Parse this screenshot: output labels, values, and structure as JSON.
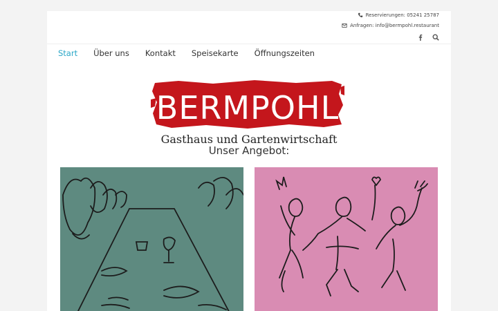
{
  "header": {
    "reservation": "Reservierungen: 05241 25787",
    "inquiries": "Anfragen: info@bermpohl.restaurant",
    "icons": [
      "phone-icon",
      "envelope-icon",
      "facebook-icon",
      "search-icon"
    ]
  },
  "nav": {
    "items": [
      {
        "label": "Start",
        "active": true
      },
      {
        "label": "Über uns"
      },
      {
        "label": "Kontakt"
      },
      {
        "label": "Speisekarte"
      },
      {
        "label": "Öffnungszeiten"
      }
    ]
  },
  "brand": {
    "logo_text": "BERMPOHL",
    "tagline": "Gasthaus und Gartenwirtschaft",
    "logo_color": "#c4161c"
  },
  "main": {
    "section_title": "Unser Angebot:",
    "cards": [
      {
        "name": "restaurant-illustration",
        "color": "#5e8a80"
      },
      {
        "name": "dancing-people-illustration",
        "color": "#d98cb3"
      }
    ]
  },
  "colors": {
    "accent": "#2aa7c7"
  }
}
